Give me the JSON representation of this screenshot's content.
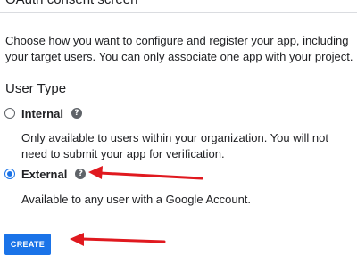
{
  "page": {
    "title": "OAuth consent screen"
  },
  "intro": {
    "description": "Choose how you want to configure and register your app, including your target users. You can only associate one app with your project."
  },
  "user_type": {
    "heading": "User Type",
    "options": [
      {
        "label": "Internal",
        "selected": false,
        "description": "Only available to users within your organization. You will not need to submit your app for verification.",
        "help_icon": "help-icon"
      },
      {
        "label": "External",
        "selected": true,
        "description": "Available to any user with a Google Account.",
        "help_icon": "help-icon"
      }
    ]
  },
  "actions": {
    "create_label": "CREATE"
  },
  "colors": {
    "accent": "#1a73e8",
    "annotation_arrow": "#e0191f",
    "text": "#202124",
    "icon_gray": "#5f6368"
  }
}
